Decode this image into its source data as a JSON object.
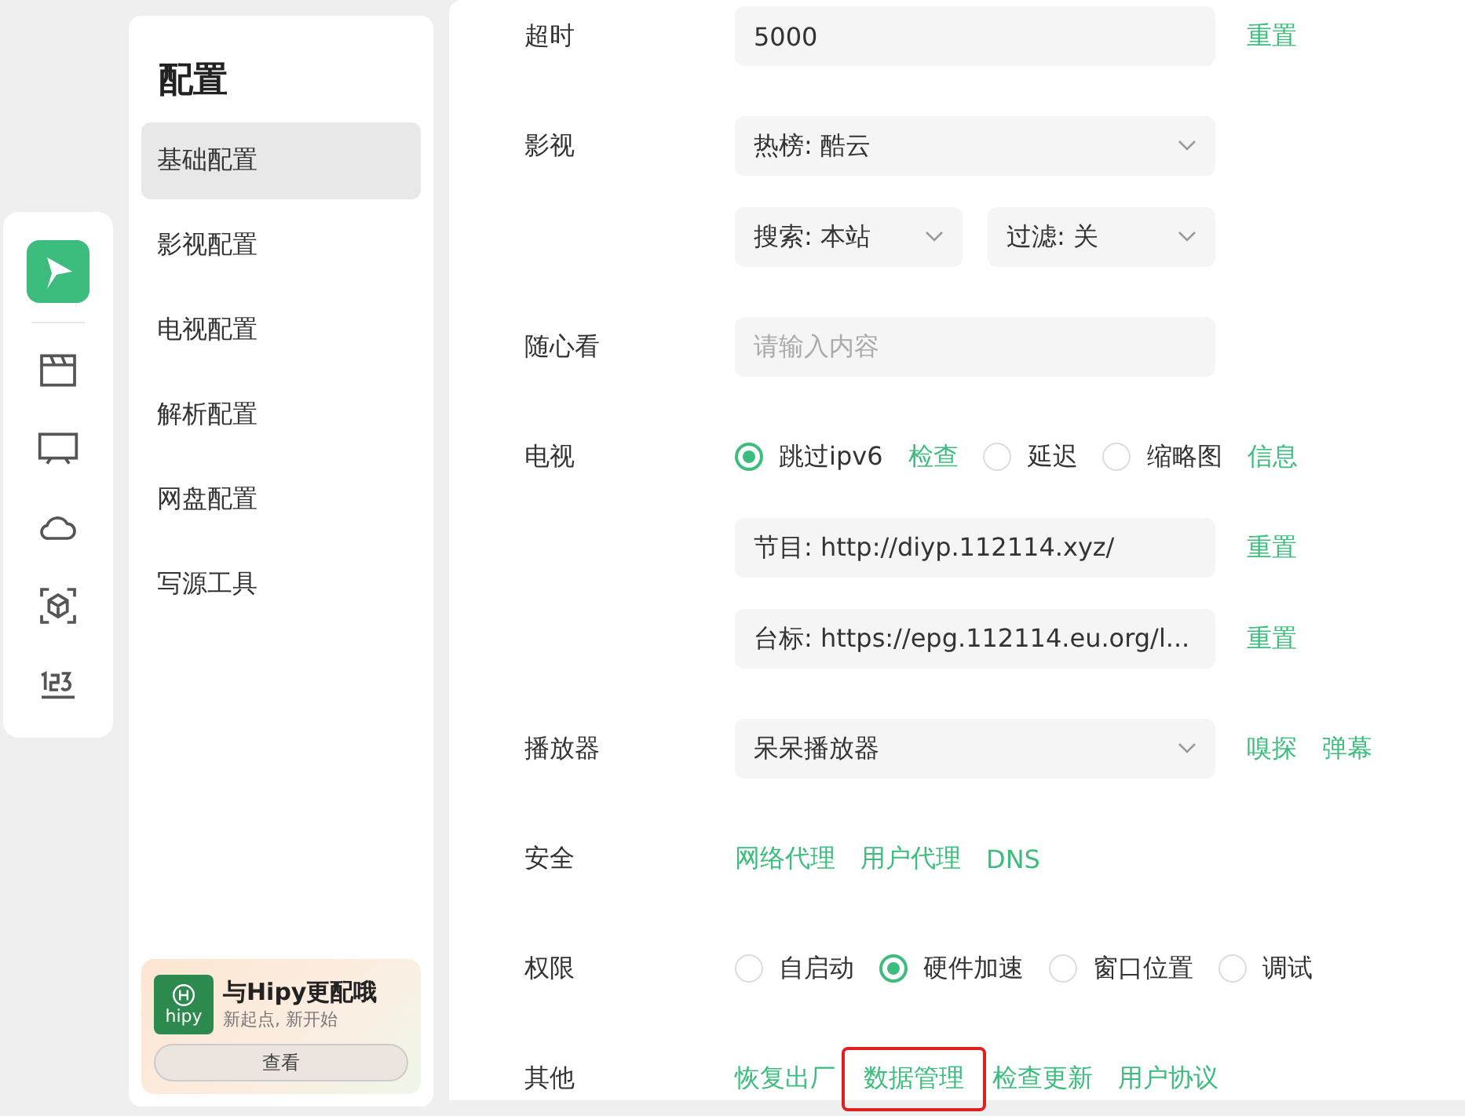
{
  "sidebar": {
    "title": "配置",
    "items": [
      {
        "label": "基础配置",
        "selected": true
      },
      {
        "label": "影视配置",
        "selected": false
      },
      {
        "label": "电视配置",
        "selected": false
      },
      {
        "label": "解析配置",
        "selected": false
      },
      {
        "label": "网盘配置",
        "selected": false
      },
      {
        "label": "写源工具",
        "selected": false
      }
    ]
  },
  "promo": {
    "logo_text": "hipy",
    "title": "与Hipy更配哦",
    "subtitle": "新起点, 新开始",
    "button": "查看"
  },
  "settings": [
    {
      "label": "超时",
      "lines": [
        [
          {
            "kind": "input",
            "value": "5000"
          },
          {
            "kind": "link",
            "label": "重置"
          }
        ]
      ]
    },
    {
      "label": "影视",
      "lines": [
        [
          {
            "kind": "select",
            "value": "热榜: 酷云"
          }
        ],
        [
          {
            "kind": "select",
            "value": "搜索: 本站"
          },
          {
            "kind": "select",
            "value": "过滤: 关"
          }
        ]
      ]
    },
    {
      "label": "随心看",
      "lines": [
        [
          {
            "kind": "input",
            "placeholder": "请输入内容"
          }
        ]
      ]
    },
    {
      "label": "电视",
      "lines": [
        [
          {
            "kind": "radio",
            "label": "跳过ipv6",
            "checked": true
          },
          {
            "kind": "link",
            "label": "检查"
          },
          {
            "kind": "radio",
            "label": "延迟",
            "checked": false
          },
          {
            "kind": "radio",
            "label": "缩略图",
            "checked": false
          },
          {
            "kind": "link",
            "label": "信息"
          }
        ],
        [
          {
            "kind": "input",
            "value": "节目: http://diyp.112114.xyz/"
          },
          {
            "kind": "link",
            "label": "重置"
          }
        ],
        [
          {
            "kind": "input",
            "value": "台标: https://epg.112114.eu.org/l..."
          },
          {
            "kind": "link",
            "label": "重置"
          }
        ]
      ]
    },
    {
      "label": "播放器",
      "lines": [
        [
          {
            "kind": "select",
            "value": "呆呆播放器"
          },
          {
            "kind": "link",
            "label": "嗅探"
          },
          {
            "kind": "link",
            "label": "弹幕"
          }
        ]
      ]
    },
    {
      "label": "安全",
      "lines": [
        [
          {
            "kind": "link",
            "label": "网络代理"
          },
          {
            "kind": "link",
            "label": "用户代理"
          },
          {
            "kind": "link",
            "label": "DNS"
          }
        ]
      ]
    },
    {
      "label": "权限",
      "lines": [
        [
          {
            "kind": "radio",
            "label": "自启动",
            "checked": false
          },
          {
            "kind": "radio",
            "label": "硬件加速",
            "checked": true
          },
          {
            "kind": "radio",
            "label": "窗口位置",
            "checked": false
          },
          {
            "kind": "radio",
            "label": "调试",
            "checked": false
          }
        ]
      ]
    },
    {
      "label": "其他",
      "lines": [
        [
          {
            "kind": "link",
            "label": "恢复出厂",
            "highlighted": false
          },
          {
            "kind": "link",
            "label": "数据管理",
            "highlighted": true
          },
          {
            "kind": "link",
            "label": "检查更新",
            "highlighted": false
          },
          {
            "kind": "link",
            "label": "用户协议",
            "highlighted": false
          }
        ]
      ]
    }
  ]
}
